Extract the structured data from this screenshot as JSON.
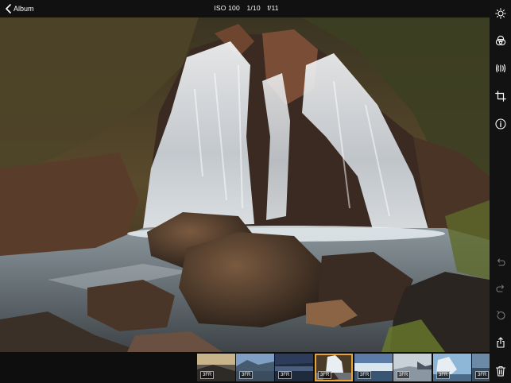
{
  "header": {
    "back_label": "Album",
    "iso": "ISO 100",
    "shutter": "1/10",
    "aperture": "f/11"
  },
  "toolbar": {
    "top_icons": [
      "brightness-icon",
      "color-filter-icon",
      "audio-wave-icon",
      "crop-icon",
      "info-icon"
    ],
    "bottom_icons": [
      "undo-icon",
      "redo-icon",
      "revert-icon",
      "share-icon",
      "delete-icon"
    ]
  },
  "filmstrip": {
    "selected_index": 3,
    "accent": "#e8a33b",
    "thumbnails": [
      {
        "label": "3FR"
      },
      {
        "label": "3FR"
      },
      {
        "label": "3FR"
      },
      {
        "label": "3FR"
      },
      {
        "label": "3FR"
      },
      {
        "label": "3FR"
      },
      {
        "label": "3FR"
      },
      {
        "label": "3FR"
      }
    ]
  }
}
